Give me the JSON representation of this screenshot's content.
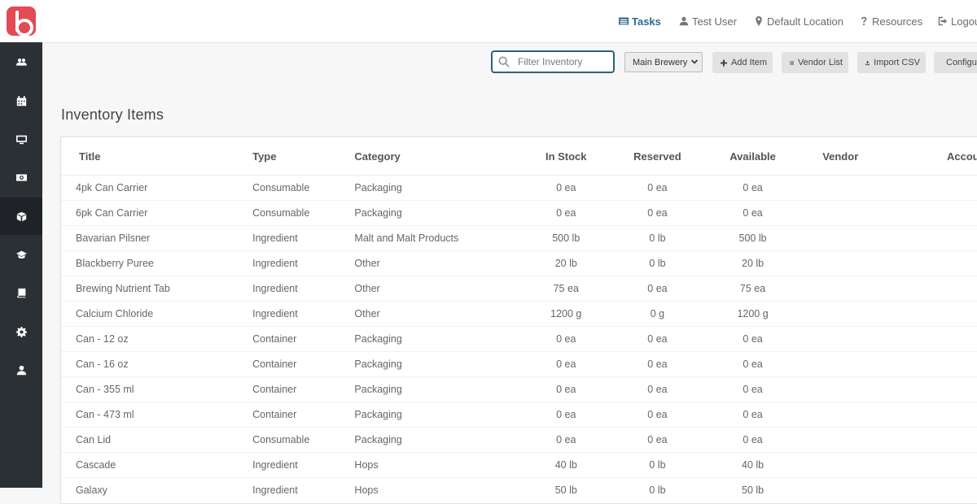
{
  "sidebar": {
    "items": [
      {
        "icon": "users-icon",
        "active": false
      },
      {
        "icon": "calendar-icon",
        "active": false
      },
      {
        "icon": "monitor-icon",
        "active": false
      },
      {
        "icon": "money-icon",
        "active": false
      },
      {
        "icon": "inventory-icon",
        "active": true
      },
      {
        "icon": "graduation-cap-icon",
        "active": false
      },
      {
        "icon": "book-icon",
        "active": false
      },
      {
        "icon": "gear-icon",
        "active": false
      },
      {
        "icon": "user-icon",
        "active": false
      }
    ]
  },
  "header": {
    "nav": {
      "tasks": "Tasks",
      "user": "Test User",
      "location": "Default Location",
      "resources": "Resources",
      "logout": "Logout"
    }
  },
  "toolbar": {
    "filter_placeholder": "Filter Inventory",
    "filter_value": "",
    "location_select": "Main Brewery",
    "add_item": "Add Item",
    "vendor_list": "Vendor List",
    "import_csv": "Import CSV",
    "config": "Configure"
  },
  "page": {
    "title": "Inventory Items"
  },
  "table": {
    "columns": [
      "Title",
      "Type",
      "Category",
      "In Stock",
      "Reserved",
      "Available",
      "Vendor",
      "Account"
    ],
    "rows": [
      {
        "title": "4pk Can Carrier",
        "type": "Consumable",
        "category": "Packaging",
        "in_stock": "0 ea",
        "reserved": "0 ea",
        "available": "0 ea",
        "vendor": "",
        "account": "--"
      },
      {
        "title": "6pk Can Carrier",
        "type": "Consumable",
        "category": "Packaging",
        "in_stock": "0 ea",
        "reserved": "0 ea",
        "available": "0 ea",
        "vendor": "",
        "account": "--"
      },
      {
        "title": "Bavarian Pilsner",
        "type": "Ingredient",
        "category": "Malt and Malt Products",
        "in_stock": "500 lb",
        "reserved": "0 lb",
        "available": "500 lb",
        "vendor": "",
        "account": "--"
      },
      {
        "title": "Blackberry Puree",
        "type": "Ingredient",
        "category": "Other",
        "in_stock": "20 lb",
        "reserved": "0 lb",
        "available": "20 lb",
        "vendor": "",
        "account": "--"
      },
      {
        "title": "Brewing Nutrient Tab",
        "type": "Ingredient",
        "category": "Other",
        "in_stock": "75 ea",
        "reserved": "0 ea",
        "available": "75 ea",
        "vendor": "",
        "account": "--"
      },
      {
        "title": "Calcium Chloride",
        "type": "Ingredient",
        "category": "Other",
        "in_stock": "1200 g",
        "reserved": "0 g",
        "available": "1200 g",
        "vendor": "",
        "account": "--"
      },
      {
        "title": "Can - 12 oz",
        "type": "Container",
        "category": "Packaging",
        "in_stock": "0 ea",
        "reserved": "0 ea",
        "available": "0 ea",
        "vendor": "",
        "account": "--"
      },
      {
        "title": "Can - 16 oz",
        "type": "Container",
        "category": "Packaging",
        "in_stock": "0 ea",
        "reserved": "0 ea",
        "available": "0 ea",
        "vendor": "",
        "account": "--"
      },
      {
        "title": "Can - 355 ml",
        "type": "Container",
        "category": "Packaging",
        "in_stock": "0 ea",
        "reserved": "0 ea",
        "available": "0 ea",
        "vendor": "",
        "account": "--"
      },
      {
        "title": "Can - 473 ml",
        "type": "Container",
        "category": "Packaging",
        "in_stock": "0 ea",
        "reserved": "0 ea",
        "available": "0 ea",
        "vendor": "",
        "account": "--"
      },
      {
        "title": "Can Lid",
        "type": "Consumable",
        "category": "Packaging",
        "in_stock": "0 ea",
        "reserved": "0 ea",
        "available": "0 ea",
        "vendor": "",
        "account": "--"
      },
      {
        "title": "Cascade",
        "type": "Ingredient",
        "category": "Hops",
        "in_stock": "40 lb",
        "reserved": "0 lb",
        "available": "40 lb",
        "vendor": "",
        "account": "--"
      },
      {
        "title": "Galaxy",
        "type": "Ingredient",
        "category": "Hops",
        "in_stock": "50 lb",
        "reserved": "0 lb",
        "available": "50 lb",
        "vendor": "",
        "account": "--"
      }
    ]
  },
  "colors": {
    "sidebar_bg": "#2b3035",
    "brand_red": "#e24a55",
    "accent_blue": "#2d6b8a"
  }
}
